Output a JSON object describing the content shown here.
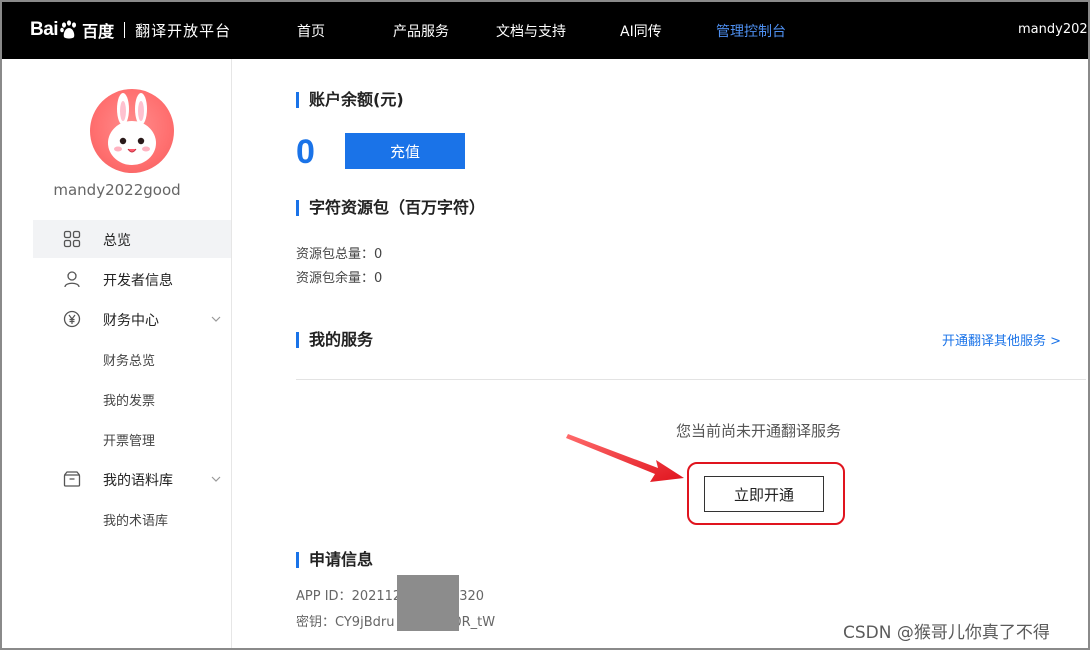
{
  "topbar": {
    "logo_text": "Bai",
    "logo_cn": "百度",
    "platform": "翻译开放平台",
    "nav": [
      "首页",
      "产品服务",
      "文档与支持",
      "AI同传",
      "管理控制台"
    ],
    "active_nav": "管理控制台",
    "user": "mandy2022"
  },
  "sidebar": {
    "username": "mandy2022good",
    "menu": [
      {
        "label": "总览",
        "icon": "grid-icon"
      },
      {
        "label": "开发者信息",
        "icon": "user-icon"
      },
      {
        "label": "财务中心",
        "icon": "yen-icon"
      },
      {
        "label": "我的语料库",
        "icon": "box-icon"
      }
    ],
    "finance_sub": [
      "财务总览",
      "我的发票",
      "开票管理"
    ],
    "corpus_sub": [
      "我的术语库"
    ]
  },
  "main": {
    "balance_title": "账户余额(元)",
    "balance": "0",
    "recharge": "充值",
    "package_title": "字符资源包（百万字符）",
    "package_total_label": "资源包总量：",
    "package_total": "0",
    "package_remain_label": "资源包余量：",
    "package_remain": "0",
    "services_title": "我的服务",
    "open_other": "开通翻译其他服务 >",
    "empty_msg": "您当前尚未开通翻译服务",
    "open_now": "立即开通",
    "apply_title": "申请信息",
    "app_id_label": "APP ID：",
    "app_id_a": "202112",
    "app_id_b": "320",
    "key_label": "密钥：",
    "key_a": "CY9jBdru",
    "key_b": "B0R_tW"
  },
  "watermark": "CSDN @猴哥儿你真了不得",
  "colors": {
    "accent": "#1a73e8",
    "highlight": "#e0141e",
    "topbar": "#000000"
  }
}
